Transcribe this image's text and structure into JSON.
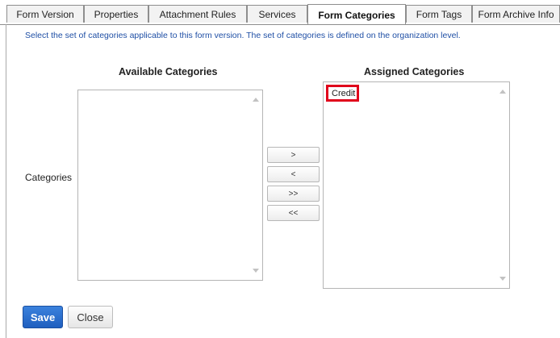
{
  "tabs": [
    {
      "label": "Form Version",
      "active": false
    },
    {
      "label": "Properties",
      "active": false
    },
    {
      "label": "Attachment Rules",
      "active": false
    },
    {
      "label": "Services",
      "active": false
    },
    {
      "label": "Form Categories",
      "active": true
    },
    {
      "label": "Form Tags",
      "active": false
    },
    {
      "label": "Form Archive Info",
      "active": false
    }
  ],
  "instruction": "Select the set of categories applicable to this form version. The set of categories is defined on the organization level.",
  "field_label": "Categories",
  "available": {
    "heading": "Available Categories",
    "items": []
  },
  "assigned": {
    "heading": "Assigned Categories",
    "items": [
      "Credit"
    ]
  },
  "move_buttons": {
    "add": ">",
    "remove": "<",
    "add_all": ">>",
    "remove_all": "<<"
  },
  "actions": {
    "save": "Save",
    "close": "Close"
  },
  "colors": {
    "primary_button": "#2666c8",
    "instruction_text": "#1f4fa5",
    "highlight_border": "#e0001b"
  },
  "icons": {
    "scroll_up": "scroll-up-arrow-icon",
    "scroll_down": "scroll-down-arrow-icon"
  }
}
